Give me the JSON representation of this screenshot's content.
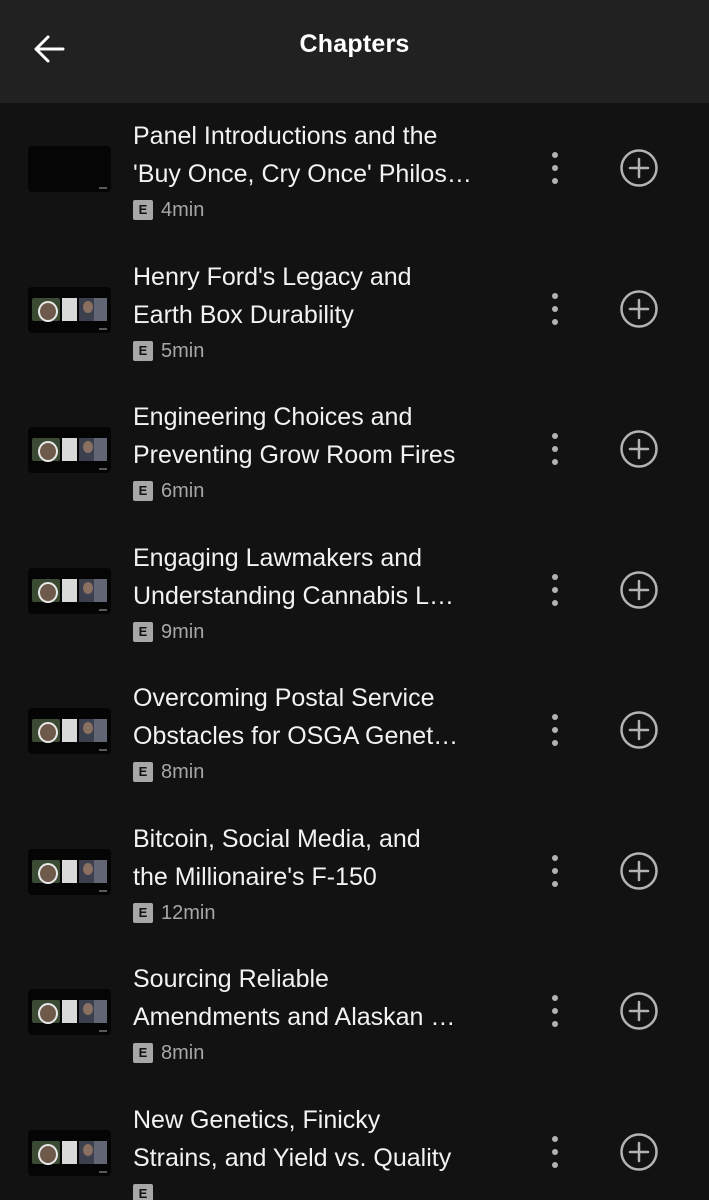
{
  "header": {
    "title": "Chapters",
    "back_icon": "arrow-left-icon"
  },
  "chapters": [
    {
      "title_line1": "Panel Introductions and the",
      "title_line2": "'Buy Once, Cry Once' Philos…",
      "explicit": "E",
      "duration": "4min"
    },
    {
      "title_line1": "Henry Ford's Legacy and",
      "title_line2": "Earth Box Durability",
      "explicit": "E",
      "duration": "5min"
    },
    {
      "title_line1": "Engineering Choices and",
      "title_line2": "Preventing Grow Room Fires",
      "explicit": "E",
      "duration": "6min"
    },
    {
      "title_line1": "Engaging Lawmakers and",
      "title_line2": "Understanding Cannabis L…",
      "explicit": "E",
      "duration": "9min"
    },
    {
      "title_line1": "Overcoming Postal Service",
      "title_line2": "Obstacles for OSGA Genet…",
      "explicit": "E",
      "duration": "8min"
    },
    {
      "title_line1": "Bitcoin, Social Media, and",
      "title_line2": "the Millionaire's F-150",
      "explicit": "E",
      "duration": "12min"
    },
    {
      "title_line1": "Sourcing Reliable",
      "title_line2": "Amendments and Alaskan …",
      "explicit": "E",
      "duration": "8min"
    },
    {
      "title_line1": "New Genetics, Finicky",
      "title_line2": "Strains, and Yield vs. Quality",
      "explicit": "E",
      "duration": ""
    }
  ],
  "icons": {
    "more": "more-vertical-icon",
    "add": "plus-circle-icon"
  },
  "colors": {
    "background": "#121212",
    "header": "#212121",
    "text_primary": "#f2f2f2",
    "text_secondary": "#a7a7a7"
  }
}
